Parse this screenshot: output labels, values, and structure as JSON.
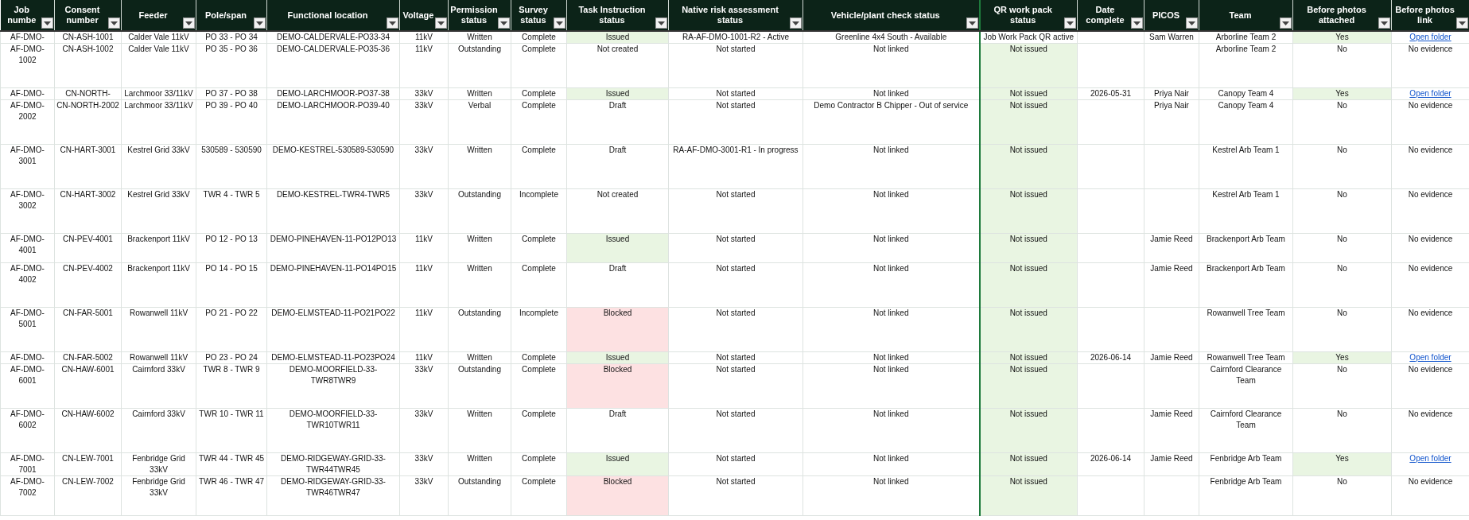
{
  "sheet": {
    "columns": [
      {
        "label": "Job numbe"
      },
      {
        "label": "Consent number"
      },
      {
        "label": "Feeder"
      },
      {
        "label": "Pole/span"
      },
      {
        "label": "Functional location"
      },
      {
        "label": "Voltage"
      },
      {
        "label": "Permission status"
      },
      {
        "label": "Survey status"
      },
      {
        "label": "Task Instruction status"
      },
      {
        "label": "Native risk assessment status"
      },
      {
        "label": "Vehicle/plant check status"
      },
      {
        "label": "QR work pack status"
      },
      {
        "label": "Date complete"
      },
      {
        "label": "PICOS"
      },
      {
        "label": "Team"
      },
      {
        "label": "Before photos attached"
      },
      {
        "label": "Before photos link"
      }
    ],
    "rows": [
      {
        "cells": [
          "AF-DMO-",
          "CN-ASH-1001",
          "Calder Vale 11kV",
          "PO 33 - PO 34",
          "DEMO-CALDERVALE-PO33-34",
          "11kV",
          "Written",
          "Complete",
          {
            "text": "Issued",
            "color": "#e9f5e2"
          },
          "RA-AF-DMO-1001-R2 - Active",
          "Greenline 4x4 South - Available",
          "Job Work Pack QR active",
          null,
          "Sam Warren",
          "Arborline Team 2",
          {
            "text": "Yes",
            "color": "#e9f5e2"
          },
          {
            "text": "Open folder",
            "kind": "link"
          }
        ]
      },
      {
        "cells": [
          "AF-DMO-1002",
          "CN-ASH-1002",
          "Calder Vale 11kV",
          "PO 35 - PO 36",
          "DEMO-CALDERVALE-PO35-36",
          "11kV",
          "Outstanding",
          "Complete",
          "Not created",
          "Not started",
          "Not linked",
          {
            "text": "Not issued",
            "color": "#e9f5e2"
          },
          null,
          null,
          "Arborline Team 2",
          "No",
          "No evidence"
        ]
      },
      {
        "cells": [
          "AF-DMO-",
          "CN-NORTH-",
          "Larchmoor 33/11kV",
          "PO 37 - PO 38",
          "DEMO-LARCHMOOR-PO37-38",
          "33kV",
          "Written",
          "Complete",
          {
            "text": "Issued",
            "color": "#e9f5e2"
          },
          "Not started",
          "Not linked",
          {
            "text": "Not issued",
            "color": "#e9f5e2"
          },
          "2026-05-31",
          "Priya Nair",
          "Canopy Team 4",
          {
            "text": "Yes",
            "color": "#e9f5e2"
          },
          {
            "text": "Open folder",
            "kind": "link"
          }
        ]
      },
      {
        "cells": [
          "AF-DMO-2002",
          "CN-NORTH-2002",
          "Larchmoor 33/11kV",
          "PO 39 - PO 40",
          "DEMO-LARCHMOOR-PO39-40",
          "33kV",
          "Verbal",
          "Complete",
          "Draft",
          "Not started",
          "Demo Contractor B Chipper - Out of service",
          {
            "text": "Not issued",
            "color": "#e9f5e2"
          },
          null,
          "Priya Nair",
          "Canopy Team 4",
          "No",
          "No evidence"
        ]
      },
      {
        "cells": [
          "AF-DMO-3001",
          "CN-HART-3001",
          "Kestrel Grid 33kV",
          "530589 - 530590",
          "DEMO-KESTREL-530589-530590",
          "33kV",
          "Written",
          "Complete",
          "Draft",
          "RA-AF-DMO-3001-R1 - In progress",
          "Not linked",
          {
            "text": "Not issued",
            "color": "#e9f5e2"
          },
          null,
          null,
          "Kestrel Arb Team 1",
          "No",
          "No evidence"
        ]
      },
      {
        "cells": [
          "AF-DMO-3002",
          "CN-HART-3002",
          "Kestrel Grid 33kV",
          "TWR 4 - TWR 5",
          "DEMO-KESTREL-TWR4-TWR5",
          "33kV",
          "Outstanding",
          "Incomplete",
          "Not created",
          "Not started",
          "Not linked",
          {
            "text": "Not issued",
            "color": "#e9f5e2"
          },
          null,
          null,
          "Kestrel Arb Team 1",
          "No",
          "No evidence"
        ]
      },
      {
        "cells": [
          "AF-DMO-4001",
          "CN-PEV-4001",
          "Brackenport 11kV",
          "PO 12 - PO 13",
          "DEMO-PINEHAVEN-11-PO12PO13",
          "11kV",
          "Written",
          "Complete",
          {
            "text": "Issued",
            "color": "#e9f5e2"
          },
          "Not started",
          "Not linked",
          {
            "text": "Not issued",
            "color": "#e9f5e2"
          },
          null,
          "Jamie Reed",
          "Brackenport Arb Team",
          "No",
          "No evidence"
        ]
      },
      {
        "cells": [
          "AF-DMO-4002",
          "CN-PEV-4002",
          "Brackenport 11kV",
          "PO 14 - PO 15",
          "DEMO-PINEHAVEN-11-PO14PO15",
          "11kV",
          "Written",
          "Complete",
          "Draft",
          "Not started",
          "Not linked",
          {
            "text": "Not issued",
            "color": "#e9f5e2"
          },
          null,
          "Jamie Reed",
          "Brackenport Arb Team",
          "No",
          "No evidence"
        ]
      },
      {
        "cells": [
          "AF-DMO-5001",
          "CN-FAR-5001",
          "Rowanwell 11kV",
          "PO 21 - PO 22",
          "DEMO-ELMSTEAD-11-PO21PO22",
          "11kV",
          "Outstanding",
          "Incomplete",
          {
            "text": "Blocked",
            "color": "#fde1e2"
          },
          "Not started",
          "Not linked",
          {
            "text": "Not issued",
            "color": "#e9f5e2"
          },
          null,
          null,
          "Rowanwell Tree Team",
          "No",
          "No evidence"
        ]
      },
      {
        "cells": [
          "AF-DMO-",
          "CN-FAR-5002",
          "Rowanwell 11kV",
          "PO 23 - PO 24",
          "DEMO-ELMSTEAD-11-PO23PO24",
          "11kV",
          "Written",
          "Complete",
          {
            "text": "Issued",
            "color": "#e9f5e2"
          },
          "Not started",
          "Not linked",
          {
            "text": "Not issued",
            "color": "#e9f5e2"
          },
          "2026-06-14",
          "Jamie Reed",
          "Rowanwell Tree Team",
          {
            "text": "Yes",
            "color": "#e9f5e2"
          },
          {
            "text": "Open folder",
            "kind": "link"
          }
        ]
      },
      {
        "cells": [
          "AF-DMO-6001",
          "CN-HAW-6001",
          "Cairnford 33kV",
          "TWR 8 - TWR 9",
          "DEMO-MOORFIELD-33-TWR8TWR9",
          "33kV",
          "Outstanding",
          "Complete",
          {
            "text": "Blocked",
            "color": "#fde1e2"
          },
          "Not started",
          "Not linked",
          {
            "text": "Not issued",
            "color": "#e9f5e2"
          },
          null,
          null,
          "Cairnford Clearance Team",
          "No",
          "No evidence"
        ]
      },
      {
        "cells": [
          "AF-DMO-6002",
          "CN-HAW-6002",
          "Cairnford 33kV",
          "TWR 10 - TWR 11",
          "DEMO-MOORFIELD-33-TWR10TWR11",
          "33kV",
          "Written",
          "Complete",
          "Draft",
          "Not started",
          "Not linked",
          {
            "text": "Not issued",
            "color": "#e9f5e2"
          },
          null,
          "Jamie Reed",
          "Cairnford Clearance Team",
          "No",
          "No evidence"
        ]
      },
      {
        "cells": [
          "AF-DMO-7001",
          "CN-LEW-7001",
          "Fenbridge Grid 33kV",
          "TWR 44 - TWR 45",
          "DEMO-RIDGEWAY-GRID-33-TWR44TWR45",
          "33kV",
          "Written",
          "Complete",
          {
            "text": "Issued",
            "color": "#e9f5e2"
          },
          "Not started",
          "Not linked",
          {
            "text": "Not issued",
            "color": "#e9f5e2"
          },
          "2026-06-14",
          "Jamie Reed",
          "Fenbridge Arb Team",
          {
            "text": "Yes",
            "color": "#e9f5e2"
          },
          {
            "text": "Open folder",
            "kind": "link"
          }
        ]
      },
      {
        "cells": [
          "AF-DMO-7002",
          "CN-LEW-7002",
          "Fenbridge Grid 33kV",
          "TWR 46 - TWR 47",
          "DEMO-RIDGEWAY-GRID-33-TWR46TWR47",
          "33kV",
          "Outstanding",
          "Complete",
          {
            "text": "Blocked",
            "color": "#fde1e2"
          },
          "Not started",
          "Not linked",
          {
            "text": "Not issued",
            "color": "#e9f5e2"
          },
          null,
          null,
          "Fenbridge Arb Team",
          "No",
          "No evidence"
        ]
      }
    ]
  }
}
